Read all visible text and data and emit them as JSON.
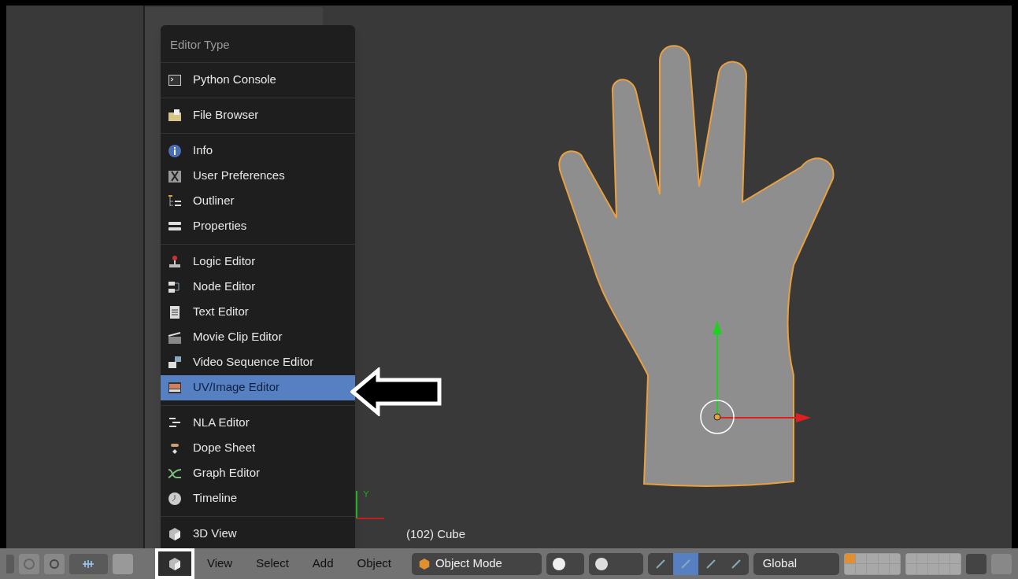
{
  "menu": {
    "title": "Editor Type",
    "groups": [
      [
        {
          "label": "Python Console",
          "selected": false
        }
      ],
      [
        {
          "label": "File Browser",
          "selected": false
        }
      ],
      [
        {
          "label": "Info",
          "selected": false
        },
        {
          "label": "User Preferences",
          "selected": false
        },
        {
          "label": "Outliner",
          "selected": false
        },
        {
          "label": "Properties",
          "selected": false
        }
      ],
      [
        {
          "label": "Logic Editor",
          "selected": false
        },
        {
          "label": "Node Editor",
          "selected": false
        },
        {
          "label": "Text Editor",
          "selected": false
        },
        {
          "label": "Movie Clip Editor",
          "selected": false
        },
        {
          "label": "Video Sequence Editor",
          "selected": false
        },
        {
          "label": "UV/Image Editor",
          "selected": true
        }
      ],
      [
        {
          "label": "NLA Editor",
          "selected": false
        },
        {
          "label": "Dope Sheet",
          "selected": false
        },
        {
          "label": "Graph Editor",
          "selected": false
        },
        {
          "label": "Timeline",
          "selected": false
        }
      ],
      [
        {
          "label": "3D View",
          "selected": false
        }
      ]
    ]
  },
  "viewport": {
    "object_info": "(102) Cube"
  },
  "header": {
    "menus": [
      "View",
      "Select",
      "Add",
      "Object"
    ],
    "mode": "Object Mode",
    "orientation": "Global",
    "manipulators": [
      {
        "selected": false
      },
      {
        "selected": true
      },
      {
        "selected": false
      },
      {
        "selected": false
      }
    ]
  }
}
